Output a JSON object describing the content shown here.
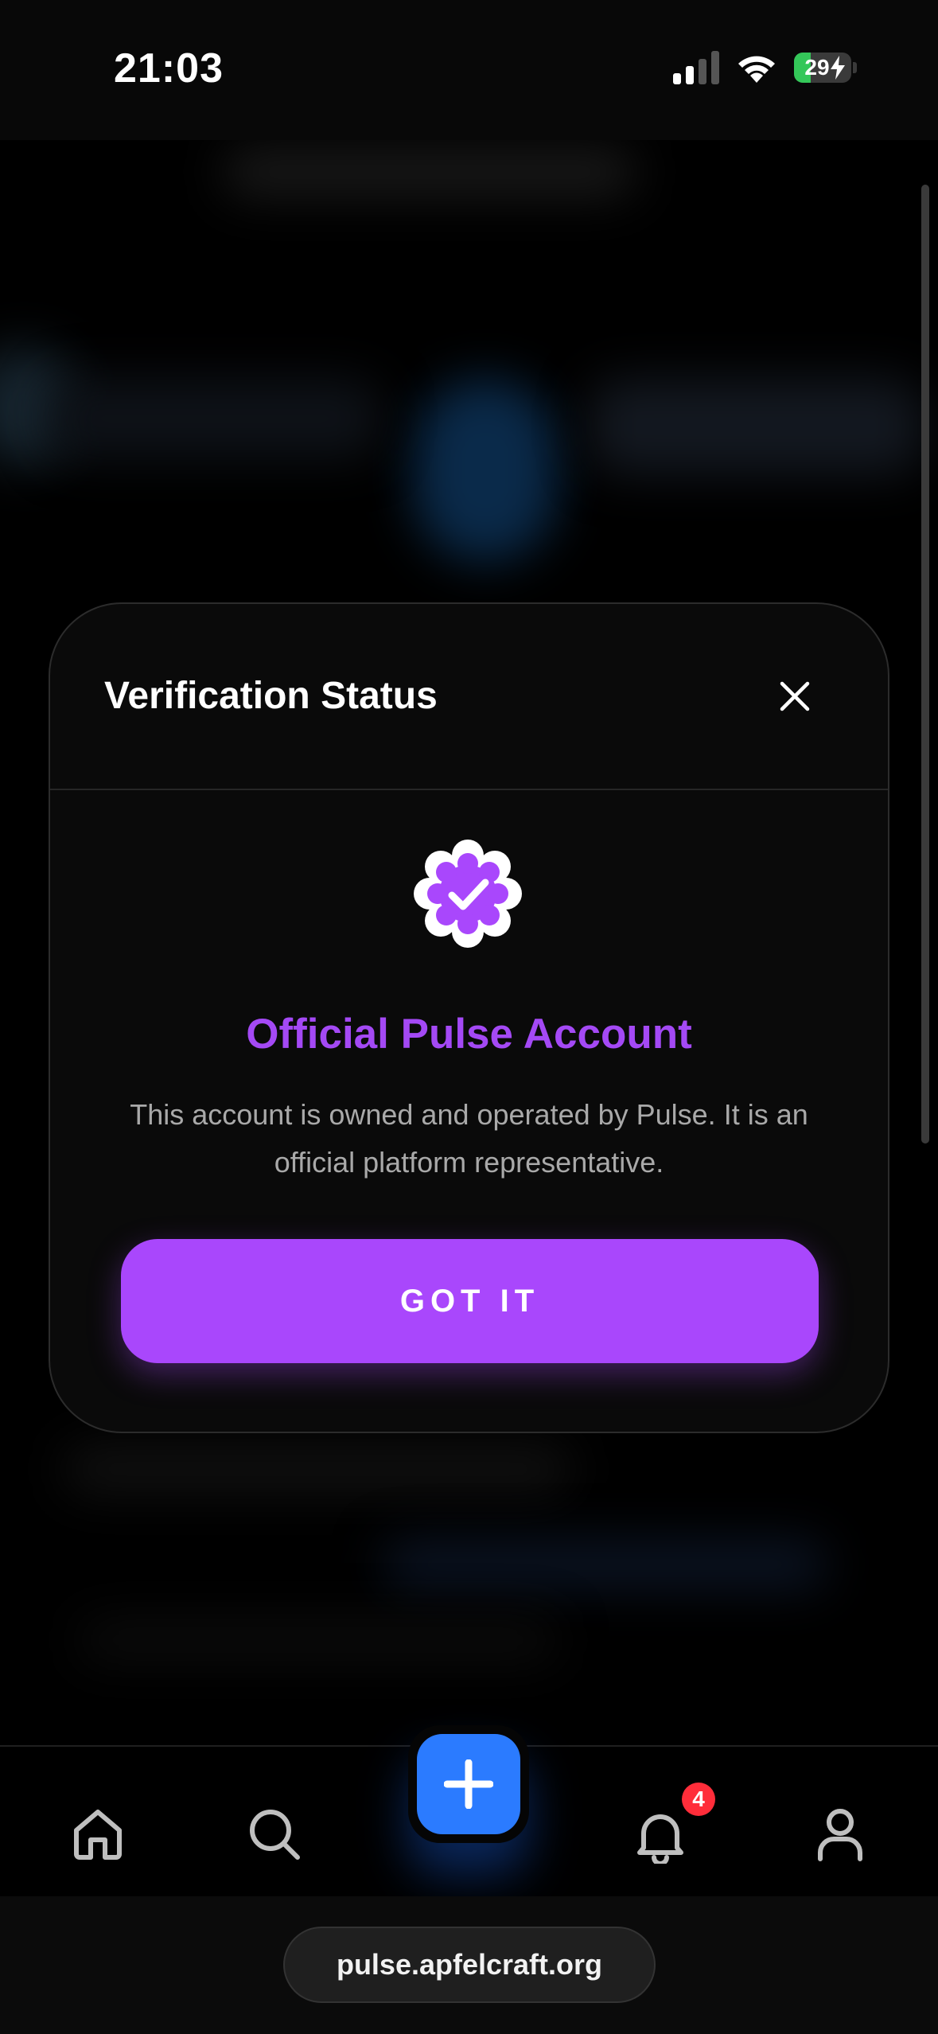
{
  "status_bar": {
    "time": "21:03",
    "battery_percent": "29",
    "battery_level": 0.29,
    "icons": [
      "signal-icon",
      "wifi-icon",
      "battery-icon",
      "charging-bolt-icon"
    ]
  },
  "modal": {
    "title": "Verification Status",
    "close_icon": "close-icon",
    "badge_icon": "verified-badge-icon",
    "heading": "Official Pulse Account",
    "body": "This account is owned and operated by Pulse. It is an official platform representative.",
    "button_label": "GOT IT"
  },
  "tab_bar": {
    "items": [
      {
        "name": "home",
        "icon": "home-icon"
      },
      {
        "name": "search",
        "icon": "search-icon"
      },
      {
        "name": "compose",
        "icon": "plus-icon"
      },
      {
        "name": "notifications",
        "icon": "bell-icon"
      },
      {
        "name": "profile",
        "icon": "profile-icon"
      }
    ],
    "notification_count": "4"
  },
  "browser": {
    "url": "pulse.apfelcraft.org"
  },
  "colors": {
    "accent_purple": "#a947fc",
    "heading_purple": "#a449f5",
    "compose_blue": "#2b7bff",
    "badge_red": "#ff2d3a",
    "battery_green": "#34c759"
  }
}
